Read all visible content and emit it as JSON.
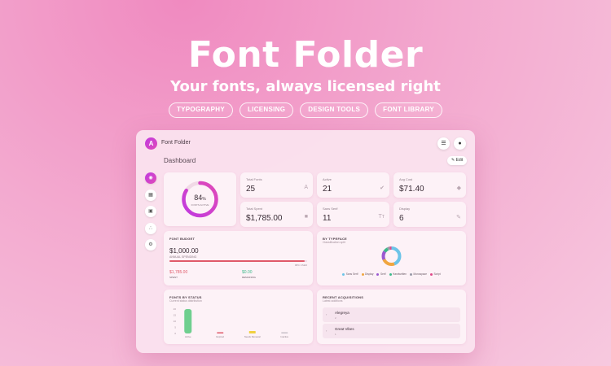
{
  "hero": {
    "title": "Font Folder",
    "subtitle": "Your fonts, always licensed right",
    "tags": [
      "TYPOGRAPHY",
      "LICENSING",
      "DESIGN TOOLS",
      "FONT LIBRARY"
    ]
  },
  "app": {
    "logo_glyph": "A",
    "name": "Font Folder",
    "menu_icon": "menu-icon",
    "user_icon": "user-icon",
    "page_title": "Dashboard",
    "edit_label": "Edit",
    "sidebar": [
      {
        "icon": "dashboard-icon",
        "active": true
      },
      {
        "icon": "calendar-icon",
        "active": false
      },
      {
        "icon": "grid-icon",
        "active": false
      },
      {
        "icon": "hierarchy-icon",
        "active": false
      },
      {
        "icon": "settings-icon",
        "active": false
      }
    ],
    "gauge": {
      "value": "84",
      "unit": "%",
      "label": "FONTS ACTIVE",
      "percent": 84
    },
    "stats": [
      {
        "label": "Total Fonts",
        "value": "25",
        "icon": "font-icon"
      },
      {
        "label": "Active",
        "value": "21",
        "icon": "check-circle-icon"
      },
      {
        "label": "Avg Cost",
        "value": "$71.40",
        "icon": "tag-icon"
      },
      {
        "label": "Total Spent",
        "value": "$1,785.00",
        "icon": "folder-icon"
      },
      {
        "label": "Sans Serif",
        "value": "11",
        "icon": "text-size-icon"
      },
      {
        "label": "Display",
        "value": "6",
        "icon": "pen-icon"
      }
    ],
    "budget": {
      "title": "FONT BUDGET",
      "amount": "$1,000.00",
      "amount_label": "ANNUAL SPENDING",
      "progress_label": "98% USED",
      "percent_used": 98,
      "spent_value": "$1,785.00",
      "spent_label": "SPENT",
      "remaining_value": "$0.00",
      "remaining_label": "REMAINING"
    },
    "typeface": {
      "title": "BY TYPEFACE",
      "subtitle": "Classification split",
      "legend": [
        {
          "name": "Sans Serif",
          "color": "#6cc4e8"
        },
        {
          "name": "Display",
          "color": "#f0a640"
        },
        {
          "name": "Serif",
          "color": "#9b59d0"
        },
        {
          "name": "Handwritten",
          "color": "#3cba8a"
        },
        {
          "name": "Monospace",
          "color": "#9a9aa8"
        },
        {
          "name": "Script",
          "color": "#e04a8a"
        }
      ]
    },
    "status_chart": {
      "title": "FONTS BY STATUS",
      "subtitle": "Current status distribution",
      "y_ticks": [
        "20",
        "15",
        "10",
        "5",
        "0"
      ]
    },
    "acquisitions": {
      "title": "RECENT ACQUISITIONS",
      "subtitle": "Latest additions",
      "items": [
        {
          "name": "Alegreya",
          "sub": "2"
        },
        {
          "name": "Great Vibes",
          "sub": "1"
        }
      ]
    }
  },
  "chart_data": [
    {
      "type": "pie",
      "title": "BY TYPEFACE",
      "categories": [
        "Sans Serif",
        "Display",
        "Serif",
        "Handwritten",
        "Monospace",
        "Script"
      ],
      "values": [
        11,
        6,
        4,
        2,
        1,
        1
      ]
    },
    {
      "type": "bar",
      "title": "FONTS BY STATUS",
      "categories": [
        "Active",
        "Expired",
        "Needs Renewal",
        "Inactive"
      ],
      "values": [
        21,
        1,
        2,
        1
      ],
      "ylim": [
        0,
        20
      ],
      "colors": [
        "#6fcf8f",
        "#e05a6a",
        "#f0d040",
        "#c8c0c8"
      ]
    }
  ]
}
